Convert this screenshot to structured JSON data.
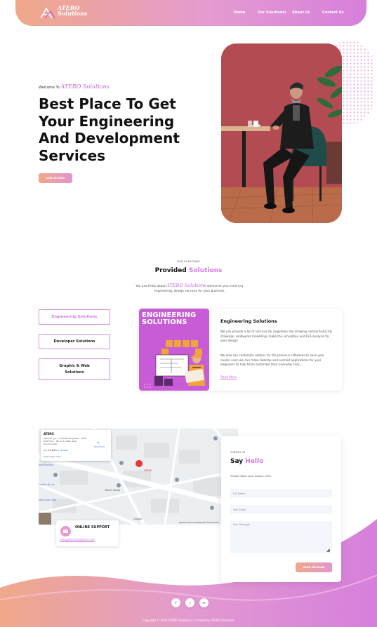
{
  "header": {
    "logo_text_1": "ATERO",
    "logo_text_2": "Solutions",
    "nav": [
      {
        "label": "Home"
      },
      {
        "label": "Our Solutions"
      },
      {
        "label": "About Us"
      },
      {
        "label": "Contact Us"
      }
    ]
  },
  "hero": {
    "welcome_prefix": "Welcome To",
    "welcome_brand": "ATERO Solutions",
    "title": "Best Place To Get Your Engineering And Development Services",
    "cta": "JOIN US NOW"
  },
  "solutions": {
    "kicker": "OUR SOLUTIONS",
    "title_plain": "Provided",
    "title_highlight": "Solutions",
    "desc_prefix": "You just think about",
    "desc_brand": "ATERO Solutions",
    "desc_suffix": "whenever you need any engineering, design services for your business.",
    "tabs": [
      {
        "label": "Engineering Solutions",
        "active": true
      },
      {
        "label": "Developer Solutions",
        "active": false
      },
      {
        "label": "Graphic & Web Solutions",
        "active": false
      }
    ],
    "card": {
      "image_title": "ENGINEERING SOLUTIONS",
      "title": "Engineering Solutions",
      "para1": "We can provide a lot of services for engineers like drawing normal AutoCAD drawings, solidworks modelling, make the simulation and FEA analysis for your design.",
      "para2": "We also can customize addons for the previous softwares to ease your needs. even we can make desktop and android applications for your engineers to help them automate their everyday task...",
      "link": "Read More"
    }
  },
  "map": {
    "place_name": "ATERO",
    "address": "100 ش 100 - (-) Dynamics garden - Giza, First Floor - Tar no 4, Giza, Giza Governorate",
    "rating": "5.0 ★★★★★",
    "reviews": "3 reviews",
    "directions": "Directions",
    "view_larger": "View larger map",
    "pin_label": "ATERO",
    "labels": [
      "oad Pavilion",
      "Option for ac",
      "Mall Dual Giza",
      "Tamer Home"
    ],
    "google": "Google",
    "footer_note": "Keyboard shortcuts  Map data ©2023  Terms"
  },
  "support": {
    "title": "ONLINE SUPPORT",
    "email": "info@aterosolutions.com"
  },
  "contact": {
    "kicker": "CONTACT US",
    "title_plain": "Say",
    "title_highlight": "Hello",
    "subtitle": "Please leave your inquiry here.",
    "name_placeholder": "Full Name",
    "email_placeholder": "Your Email",
    "message_placeholder": "Your Message",
    "submit": "SEND MESSAGE"
  },
  "footer": {
    "social": [
      {
        "icon": "facebook-icon",
        "glyph": "f"
      },
      {
        "icon": "instagram-icon",
        "glyph": "◎"
      },
      {
        "icon": "linkedin-icon",
        "glyph": "in"
      }
    ],
    "copyright": "Copyright © 2022 ATERO Solutions | Created by ATERO Solutions."
  },
  "colors": {
    "accent_pink": "#d57ae0",
    "gradient_start": "#f0a88a",
    "gradient_end": "#d67fdc",
    "photo_wall": "#b24b52",
    "card_purple": "#c75cd6"
  }
}
